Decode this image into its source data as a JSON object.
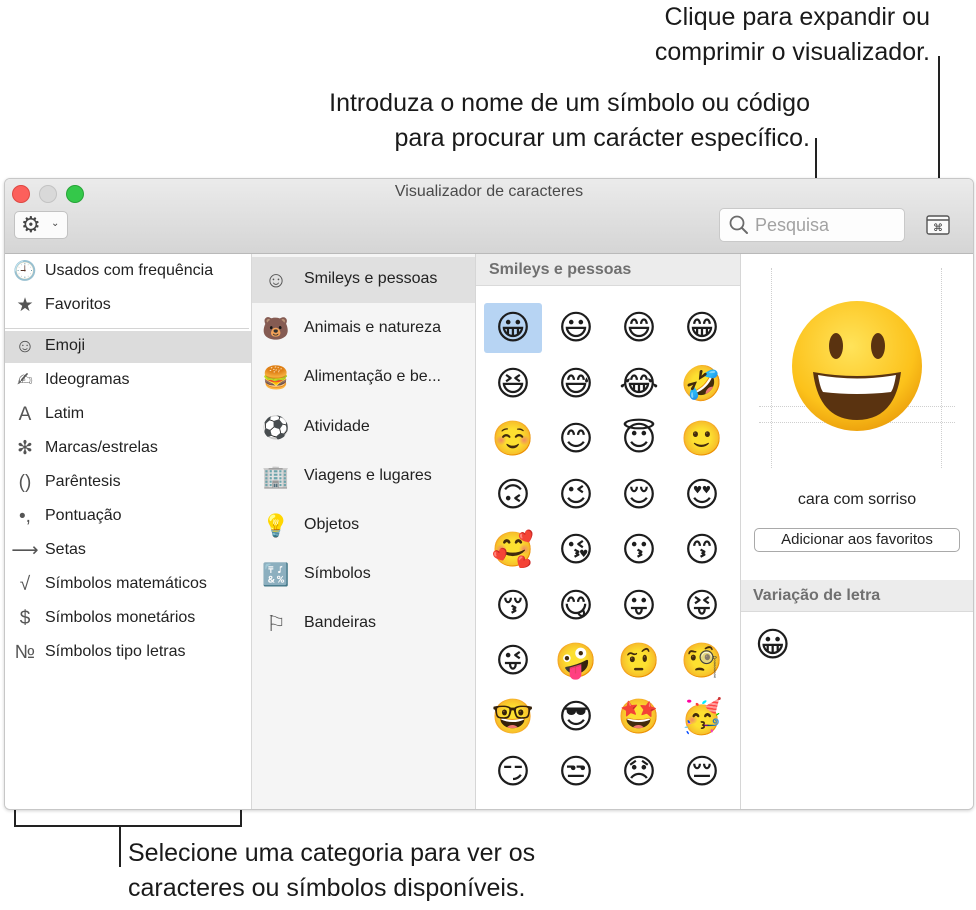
{
  "callouts": {
    "toggle": [
      "Clique para expandir ou",
      "comprimir o visualizador."
    ],
    "search": [
      "Introduza o nome de um símbolo ou código",
      "para procurar um carácter específico."
    ],
    "category": [
      "Selecione uma categoria para ver os",
      "caracteres ou símbolos disponíveis."
    ]
  },
  "window": {
    "title": "Visualizador de caracteres",
    "search_placeholder": "Pesquisa"
  },
  "sidebar": {
    "items": [
      {
        "label": "Usados com frequência",
        "icon": "clock-icon",
        "glyph": "🕘"
      },
      {
        "label": "Favoritos",
        "icon": "star-icon",
        "glyph": "★"
      },
      {
        "label": "Emoji",
        "icon": "smiley-icon",
        "glyph": "☺",
        "selected": true
      },
      {
        "label": "Ideogramas",
        "icon": "ideogram-icon",
        "glyph": "✍"
      },
      {
        "label": "Latim",
        "icon": "latin-a-icon",
        "glyph": "A"
      },
      {
        "label": "Marcas/estrelas",
        "icon": "asterisk-icon",
        "glyph": "✻"
      },
      {
        "label": "Parêntesis",
        "icon": "parentheses-icon",
        "glyph": "()"
      },
      {
        "label": "Pontuação",
        "icon": "punctuation-icon",
        "glyph": "•,"
      },
      {
        "label": "Setas",
        "icon": "arrow-icon",
        "glyph": "⟶"
      },
      {
        "label": "Símbolos matemáticos",
        "icon": "square-root-icon",
        "glyph": "√"
      },
      {
        "label": "Símbolos monetários",
        "icon": "dollar-icon",
        "glyph": "$"
      },
      {
        "label": "Símbolos tipo letras",
        "icon": "numero-icon",
        "glyph": "№"
      }
    ]
  },
  "emoji_categories": [
    {
      "label": "Smileys e pessoas",
      "icon": "smiley-outline-icon",
      "glyph": "☺",
      "selected": true
    },
    {
      "label": "Animais e natureza",
      "icon": "bear-icon",
      "glyph": "🐻"
    },
    {
      "label": "Alimentação e be...",
      "icon": "food-icon",
      "glyph": "🍔"
    },
    {
      "label": "Atividade",
      "icon": "soccer-ball-icon",
      "glyph": "⚽"
    },
    {
      "label": "Viagens e lugares",
      "icon": "buildings-icon",
      "glyph": "🏢"
    },
    {
      "label": "Objetos",
      "icon": "lightbulb-icon",
      "glyph": "💡"
    },
    {
      "label": "Símbolos",
      "icon": "symbols-icon",
      "glyph": "🔣"
    },
    {
      "label": "Bandeiras",
      "icon": "flag-icon",
      "glyph": "⚐"
    }
  ],
  "grid": {
    "header": "Smileys e pessoas",
    "emojis": [
      "😀",
      "😃",
      "😄",
      "😁",
      "😆",
      "😅",
      "😂",
      "🤣",
      "☺️",
      "😊",
      "😇",
      "🙂",
      "🙃",
      "😉",
      "😌",
      "😍",
      "🥰",
      "😘",
      "😗",
      "😙",
      "😚",
      "😋",
      "😛",
      "😝",
      "😜",
      "🤪",
      "🤨",
      "🧐",
      "🤓",
      "😎",
      "🤩",
      "🥳",
      "😏",
      "😒",
      "😞",
      "😔"
    ]
  },
  "detail": {
    "name": "cara com sorriso",
    "add_favorites": "Adicionar aos favoritos",
    "variation_header": "Variação de letra",
    "variation_emoji": "😀"
  },
  "colors": {
    "selection": "#b7d4f3",
    "sidebar_selection": "#dcdcdc",
    "close": "#fc605c",
    "maximize": "#34c84a"
  }
}
